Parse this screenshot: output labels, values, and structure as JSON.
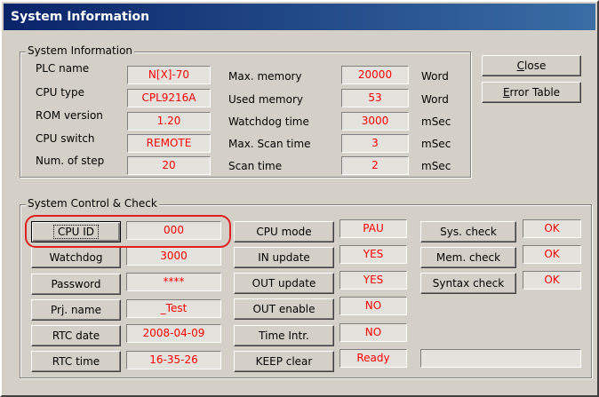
{
  "window": {
    "title": "System Information"
  },
  "sysinfo": {
    "group_title": "System Information",
    "left": [
      {
        "label": "PLC name",
        "value": "N[X]-70"
      },
      {
        "label": "CPU type",
        "value": "CPL9216A"
      },
      {
        "label": "ROM version",
        "value": "1.20"
      },
      {
        "label": "CPU switch",
        "value": "REMOTE"
      },
      {
        "label": "Num. of step",
        "value": "20"
      }
    ],
    "right": [
      {
        "label": "Max. memory",
        "value": "20000",
        "unit": "Word"
      },
      {
        "label": "Used memory",
        "value": "53",
        "unit": "Word"
      },
      {
        "label": "Watchdog time",
        "value": "3000",
        "unit": "mSec"
      },
      {
        "label": "Max. Scan time",
        "value": "3",
        "unit": "mSec"
      },
      {
        "label": "Scan time",
        "value": "2",
        "unit": "mSec"
      }
    ]
  },
  "buttons": {
    "close_first": "C",
    "close_rest": "lose",
    "error_first": "E",
    "error_rest": "rror Table"
  },
  "control": {
    "group_title": "System Control & Check",
    "col1": [
      {
        "label": "CPU ID",
        "value": "000"
      },
      {
        "label": "Watchdog",
        "value": "3000"
      },
      {
        "label": "Password",
        "value": "****"
      },
      {
        "label": "Prj. name",
        "value": "_Test"
      },
      {
        "label": "RTC date",
        "value": "2008-04-09"
      },
      {
        "label": "RTC time",
        "value": "16-35-26"
      }
    ],
    "col2": [
      {
        "label": "CPU mode",
        "value": "PAU"
      },
      {
        "label": "IN update",
        "value": "YES"
      },
      {
        "label": "OUT update",
        "value": "YES"
      },
      {
        "label": "OUT enable",
        "value": "NO"
      },
      {
        "label": "Time Intr.",
        "value": "NO"
      },
      {
        "label": "KEEP clear",
        "value": "Ready"
      }
    ],
    "col3": [
      {
        "label": "Sys. check",
        "value": "OK"
      },
      {
        "label": "Mem. check",
        "value": "OK"
      },
      {
        "label": "Syntax check",
        "value": "OK"
      }
    ],
    "col3_extra_value": ""
  }
}
